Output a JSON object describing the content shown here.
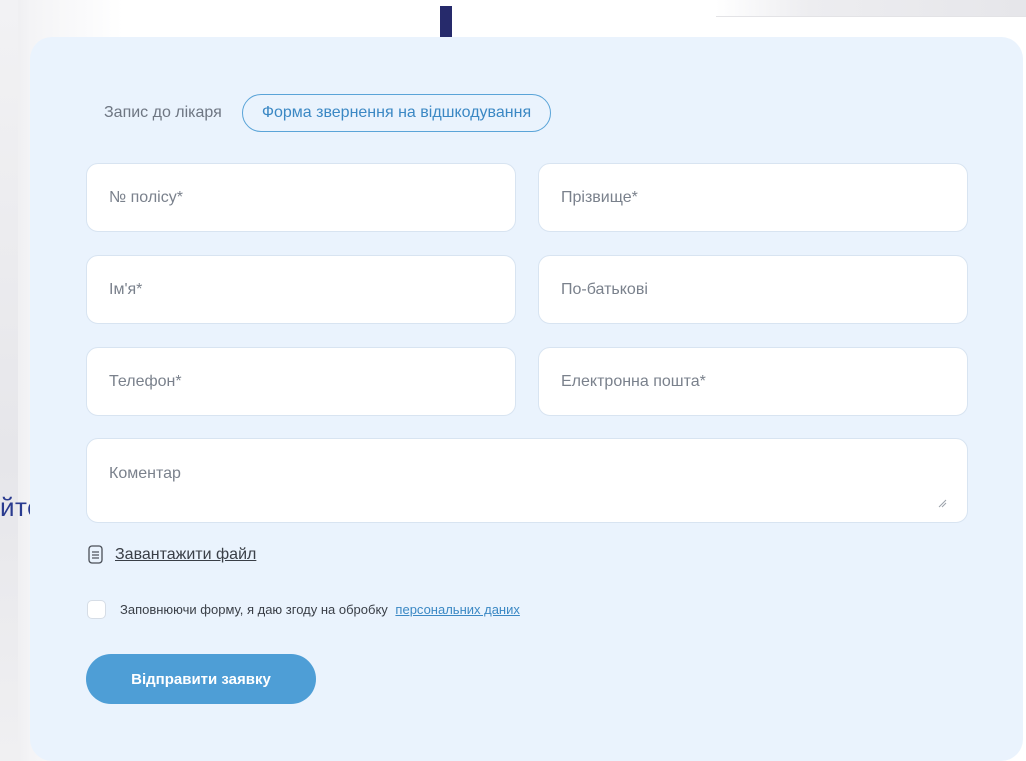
{
  "side_text": "йте",
  "tabs": {
    "doctor_appointment": "Запис до лікаря",
    "reimbursement_form": "Форма звернення на відшкодування"
  },
  "form": {
    "policy_number_placeholder": "№ полісу*",
    "surname_placeholder": "Прізвище*",
    "name_placeholder": "Ім'я*",
    "patronymic_placeholder": "По-батькові",
    "phone_placeholder": "Телефон*",
    "email_placeholder": "Електронна пошта*",
    "comment_placeholder": "Коментар",
    "upload_file_label": "Завантажити файл",
    "consent_text": "Заповнюючи форму, я даю згоду на обробку",
    "consent_link": "персональних даних",
    "submit_label": "Відправити заявку"
  },
  "colors": {
    "accent": "#4e9ed6",
    "card_background": "#eaf3fd",
    "annotation_arrow": "#262a6b"
  },
  "icons": {
    "annotation": "arrow-down-icon",
    "upload": "document-icon",
    "resize": "resize-grip-icon"
  }
}
